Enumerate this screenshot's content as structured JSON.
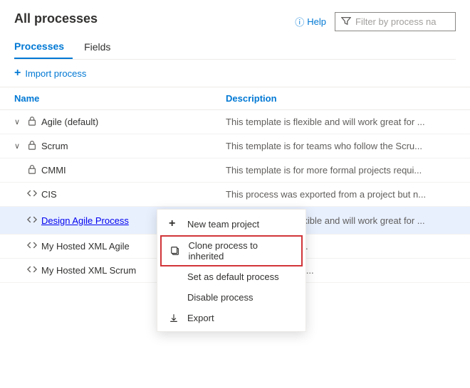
{
  "header": {
    "title": "All processes",
    "help_label": "Help",
    "filter_placeholder": "Filter by process na",
    "filter_icon": "🔽",
    "tabs": [
      {
        "id": "processes",
        "label": "Processes",
        "active": true
      },
      {
        "id": "fields",
        "label": "Fields",
        "active": false
      }
    ]
  },
  "toolbar": {
    "import_label": "Import process"
  },
  "table": {
    "columns": [
      {
        "id": "name",
        "label": "Name"
      },
      {
        "id": "description",
        "label": "Description"
      }
    ],
    "rows": [
      {
        "id": "agile",
        "chevron": "∨",
        "icon": "lock",
        "name": "Agile (default)",
        "link": false,
        "description": "This template is flexible and will work great for ...",
        "selected": false,
        "show_ellipsis": false
      },
      {
        "id": "scrum",
        "chevron": "∨",
        "icon": "lock",
        "name": "Scrum",
        "link": false,
        "description": "This template is for teams who follow the Scru...",
        "selected": false,
        "show_ellipsis": false
      },
      {
        "id": "cmmi",
        "chevron": "",
        "icon": "lock",
        "name": "CMMI",
        "link": false,
        "description": "This template is for more formal projects requi...",
        "selected": false,
        "show_ellipsis": false
      },
      {
        "id": "cis",
        "chevron": "",
        "icon": "code",
        "name": "CIS",
        "link": false,
        "description": "This process was exported from a project but n...",
        "selected": false,
        "show_ellipsis": false
      },
      {
        "id": "design-agile",
        "chevron": "",
        "icon": "code",
        "name": "Design Agile Process",
        "link": true,
        "description": "This template is flexible and will work great for ...",
        "selected": true,
        "show_ellipsis": true,
        "context_menu": true
      },
      {
        "id": "hosted-xml-agile",
        "chevron": "",
        "icon": "code",
        "name": "My Hosted XML Agile",
        "link": false,
        "description": "will work great for ...",
        "selected": false,
        "show_ellipsis": false
      },
      {
        "id": "hosted-xml-scrum",
        "chevron": "",
        "icon": "code",
        "name": "My Hosted XML Scrum",
        "link": false,
        "description": "who follow the Scru...",
        "selected": false,
        "show_ellipsis": false
      }
    ]
  },
  "context_menu": {
    "items": [
      {
        "id": "new-team-project",
        "icon": "+",
        "label": "New team project",
        "highlighted": false
      },
      {
        "id": "clone-process",
        "icon": "clone",
        "label": "Clone process to inherited",
        "highlighted": true
      },
      {
        "id": "set-default",
        "icon": "",
        "label": "Set as default process",
        "highlighted": false
      },
      {
        "id": "disable-process",
        "icon": "",
        "label": "Disable process",
        "highlighted": false
      },
      {
        "id": "export",
        "icon": "export",
        "label": "Export",
        "highlighted": false
      }
    ]
  }
}
